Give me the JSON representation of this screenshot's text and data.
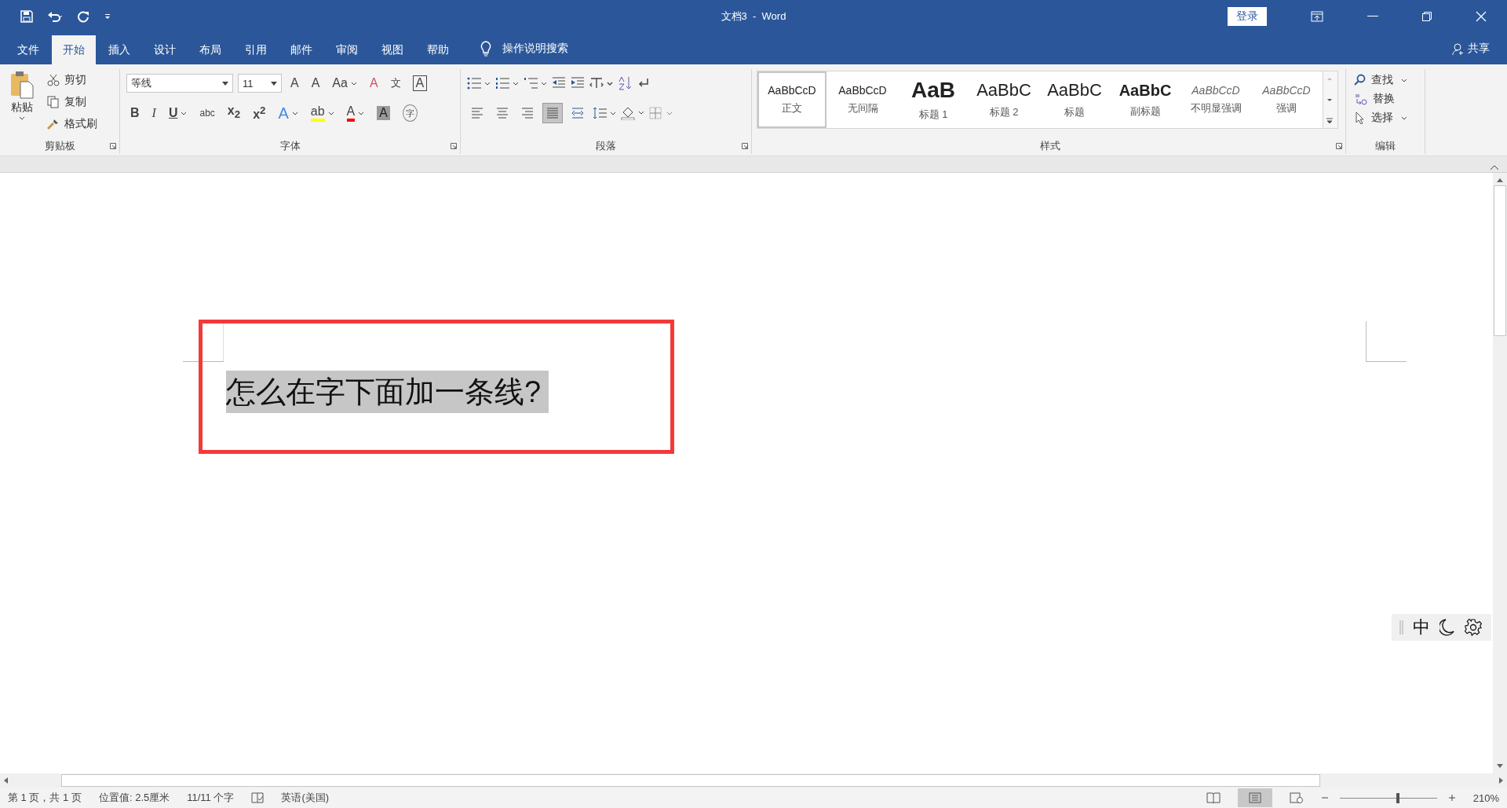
{
  "title_bar": {
    "title": "文档3  -  Word",
    "sign_in": "登录"
  },
  "tabs": [
    {
      "label": "文件",
      "selected": false
    },
    {
      "label": "开始",
      "selected": true
    },
    {
      "label": "插入",
      "selected": false
    },
    {
      "label": "设计",
      "selected": false
    },
    {
      "label": "布局",
      "selected": false
    },
    {
      "label": "引用",
      "selected": false
    },
    {
      "label": "邮件",
      "selected": false
    },
    {
      "label": "审阅",
      "selected": false
    },
    {
      "label": "视图",
      "selected": false
    },
    {
      "label": "帮助",
      "selected": false
    }
  ],
  "tell_me": "操作说明搜索",
  "share": "共享",
  "clipboard": {
    "paste": "粘贴",
    "cut": "剪切",
    "copy": "复制",
    "format_painter": "格式刷",
    "label": "剪贴板"
  },
  "font": {
    "font_name": "等线",
    "font_size": "11",
    "label": "字体",
    "row_1": [
      {
        "label": "A",
        "kind": "grow",
        "caret": false
      },
      {
        "label": "A",
        "kind": "shrink",
        "caret": false
      },
      {
        "label": "Aa",
        "kind": "plain",
        "caret": true
      },
      {
        "label": "A",
        "kind": "eraser",
        "caret": false
      },
      {
        "label": "文",
        "kind": "phonetic",
        "caret": false
      },
      {
        "label": "A",
        "kind": "boxed",
        "caret": false
      }
    ],
    "row_2": [
      {
        "label": "B",
        "kind": "bold",
        "caret": false
      },
      {
        "label": "I",
        "kind": "italic",
        "caret": false
      },
      {
        "label": "U",
        "kind": "underline",
        "caret": true
      },
      {
        "label": "abc",
        "kind": "strike",
        "caret": false
      },
      {
        "label": "x$_{2}$",
        "kind": "bold",
        "caret": false
      },
      {
        "label": "x$^{2}$",
        "kind": "bold",
        "caret": false
      },
      {
        "label": "A",
        "kind": "effect",
        "caret": true
      },
      {
        "label": "ab",
        "kind": "highlight",
        "color": "#ffff00",
        "caret": true
      },
      {
        "label": "A",
        "kind": "fontcolor",
        "color": "#ff0000",
        "caret": true
      },
      {
        "label": "A",
        "kind": "shaded",
        "caret": false
      },
      {
        "label": "字",
        "kind": "circled",
        "caret": false
      }
    ]
  },
  "paragraph": {
    "label": "段落",
    "align_buttons": [
      {
        "selected": false
      },
      {
        "selected": false
      },
      {
        "selected": false
      },
      {
        "selected": true
      },
      {
        "selected": false
      }
    ]
  },
  "styles": {
    "label": "样式",
    "items": [
      {
        "preview": "AaBbCcD",
        "name": "正文",
        "kind": "normal",
        "selected": true
      },
      {
        "preview": "AaBbCcD",
        "name": "无间隔",
        "kind": "normal",
        "selected": false
      },
      {
        "preview": "AaB",
        "name": "标题 1",
        "kind": "heading",
        "selected": false
      },
      {
        "preview": "AaBbC",
        "name": "标题 2",
        "kind": "heading2",
        "selected": false
      },
      {
        "preview": "AaBbC",
        "name": "标题",
        "kind": "title",
        "selected": false
      },
      {
        "preview": "AaBbC",
        "name": "副标题",
        "kind": "subtitle",
        "selected": false
      },
      {
        "preview": "AaBbCcD",
        "name": "不明显强调",
        "kind": "emphasis",
        "selected": false
      },
      {
        "preview": "AaBbCcD",
        "name": "强调",
        "kind": "emphasis",
        "selected": false
      }
    ]
  },
  "editing": {
    "find": "查找",
    "replace": "替换",
    "select": "选择",
    "label": "编辑"
  },
  "document": {
    "text": "怎么在字下面加一条线?",
    "selected": true,
    "annotation": true
  },
  "ime": {
    "mode": "中"
  },
  "status_bar": {
    "page": "第 1 页，共 1 页",
    "position": "位置值: 2.5厘米",
    "words": "11/11 个字",
    "language": "英语(美国)",
    "zoom": "210%",
    "zoom_slider": {
      "level": 0.6
    }
  }
}
